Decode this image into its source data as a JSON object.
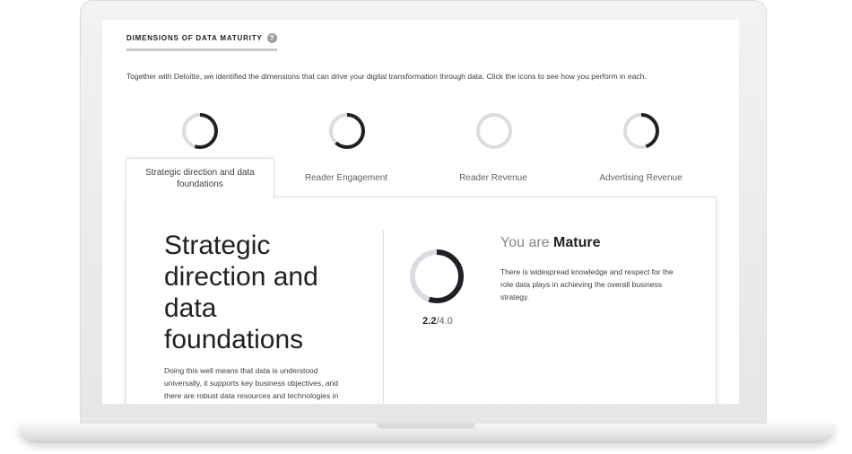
{
  "section": {
    "title": "DIMENSIONS OF DATA MATURITY",
    "help_icon": "?",
    "intro": "Together with Deloitte, we identified the dimensions that can drive your digital transformation through data. Click the icons to see how you perform in each."
  },
  "dimensions": [
    {
      "label": "Strategic direction and data foundations",
      "progress": 0.55,
      "active": true
    },
    {
      "label": "Reader Engagement",
      "progress": 0.62,
      "active": false
    },
    {
      "label": "Reader Revenue",
      "progress": 0.0,
      "active": false
    },
    {
      "label": "Advertising Revenue",
      "progress": 0.45,
      "active": false
    }
  ],
  "detail": {
    "title": "Strategic direction and data foundations",
    "description": "Doing this well means that data is understood universally, it supports key business objectives, and there are robust data resources and technologies in",
    "score_value": "2.2",
    "score_max": "/4.0",
    "score_progress": 0.55,
    "level_prefix": "You are",
    "level_name": "Mature",
    "level_description": "There is widespread knowledge and respect for the role data plays in achieving the overall business strategy."
  },
  "colors": {
    "ring_track": "#dadce0",
    "ring_fill": "#202124"
  }
}
